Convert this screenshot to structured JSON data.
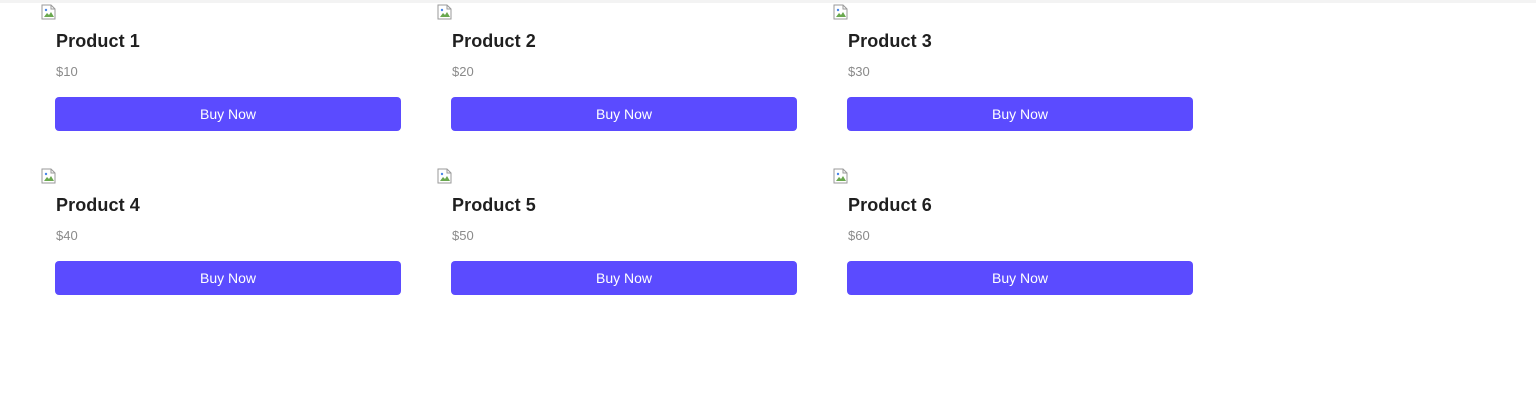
{
  "theme": {
    "accent": "#5b4bff"
  },
  "products": [
    {
      "name": "Product 1",
      "price": "$10",
      "cta": "Buy Now",
      "image_icon": "broken-image-icon"
    },
    {
      "name": "Product 2",
      "price": "$20",
      "cta": "Buy Now",
      "image_icon": "broken-image-icon"
    },
    {
      "name": "Product 3",
      "price": "$30",
      "cta": "Buy Now",
      "image_icon": "broken-image-icon"
    },
    {
      "name": "Product 4",
      "price": "$40",
      "cta": "Buy Now",
      "image_icon": "broken-image-icon"
    },
    {
      "name": "Product 5",
      "price": "$50",
      "cta": "Buy Now",
      "image_icon": "broken-image-icon"
    },
    {
      "name": "Product 6",
      "price": "$60",
      "cta": "Buy Now",
      "image_icon": "broken-image-icon"
    }
  ]
}
